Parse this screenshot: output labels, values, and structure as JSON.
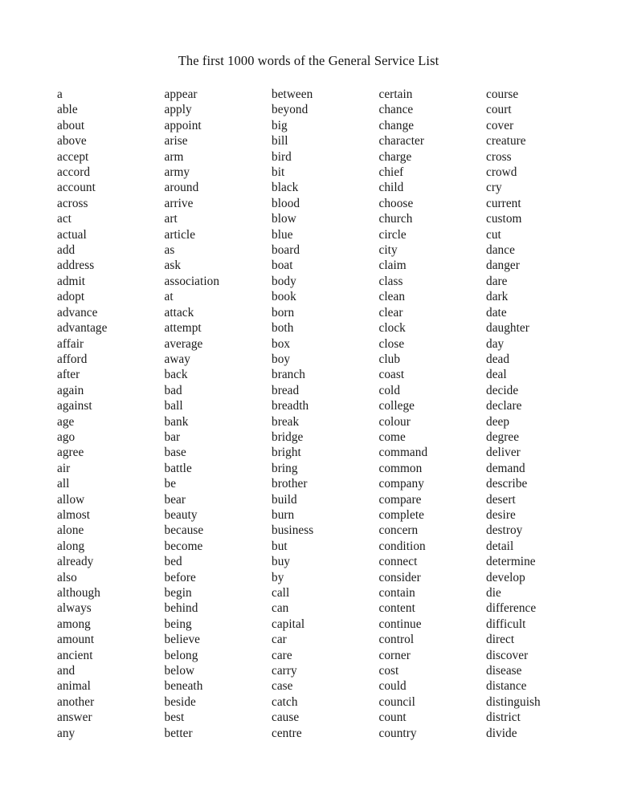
{
  "document": {
    "title": "The first 1000 words of the General Service List",
    "columns": [
      {
        "name": "column-1",
        "words": [
          "a",
          "able",
          "about",
          "above",
          "accept",
          "accord",
          "account",
          "across",
          "act",
          "actual",
          "add",
          "address",
          "admit",
          "adopt",
          "advance",
          "advantage",
          "affair",
          "afford",
          "after",
          "again",
          "against",
          "age",
          "ago",
          "agree",
          "air",
          "all",
          "allow",
          "almost",
          "alone",
          "along",
          "already",
          "also",
          "although",
          "always",
          "among",
          "amount",
          "ancient",
          "and",
          "animal",
          "another",
          "answer",
          "any"
        ]
      },
      {
        "name": "column-2",
        "words": [
          "appear",
          "apply",
          "appoint",
          "arise",
          "arm",
          "army",
          "around",
          "arrive",
          "art",
          "article",
          "as",
          "ask",
          "association",
          "at",
          "attack",
          "attempt",
          "average",
          "away",
          "back",
          "bad",
          "ball",
          "bank",
          "bar",
          "base",
          "battle",
          "be",
          "bear",
          "beauty",
          "because",
          "become",
          "bed",
          "before",
          "begin",
          "behind",
          "being",
          "believe",
          "belong",
          "below",
          "beneath",
          "beside",
          "best",
          "better"
        ]
      },
      {
        "name": "column-3",
        "words": [
          "between",
          "beyond",
          "big",
          "bill",
          "bird",
          "bit",
          "black",
          "blood",
          "blow",
          "blue",
          "board",
          "boat",
          "body",
          "book",
          "born",
          "both",
          "box",
          "boy",
          "branch",
          "bread",
          "breadth",
          "break",
          "bridge",
          "bright",
          "bring",
          "brother",
          "build",
          "burn",
          "business",
          "but",
          "buy",
          "by",
          "call",
          "can",
          "capital",
          "car",
          "care",
          "carry",
          "case",
          "catch",
          "cause",
          "centre"
        ]
      },
      {
        "name": "column-4",
        "words": [
          "certain",
          "chance",
          "change",
          "character",
          "charge",
          "chief",
          "child",
          "choose",
          "church",
          "circle",
          "city",
          "claim",
          "class",
          "clean",
          "clear",
          "clock",
          "close",
          "club",
          "coast",
          "cold",
          "college",
          "colour",
          "come",
          "command",
          "common",
          "company",
          "compare",
          "complete",
          "concern",
          "condition",
          "connect",
          "consider",
          "contain",
          "content",
          "continue",
          "control",
          "corner",
          "cost",
          "could",
          "council",
          "count",
          "country"
        ]
      },
      {
        "name": "column-5",
        "words": [
          "course",
          "court",
          "cover",
          "creature",
          "cross",
          "crowd",
          "cry",
          "current",
          "custom",
          "cut",
          "dance",
          "danger",
          "dare",
          "dark",
          "date",
          "daughter",
          "day",
          "dead",
          "deal",
          "decide",
          "declare",
          "deep",
          "degree",
          "deliver",
          "demand",
          "describe",
          "desert",
          "desire",
          "destroy",
          "detail",
          "determine",
          "develop",
          "die",
          "difference",
          "difficult",
          "direct",
          "discover",
          "disease",
          "distance",
          "distinguish",
          "district",
          "divide"
        ]
      }
    ]
  }
}
